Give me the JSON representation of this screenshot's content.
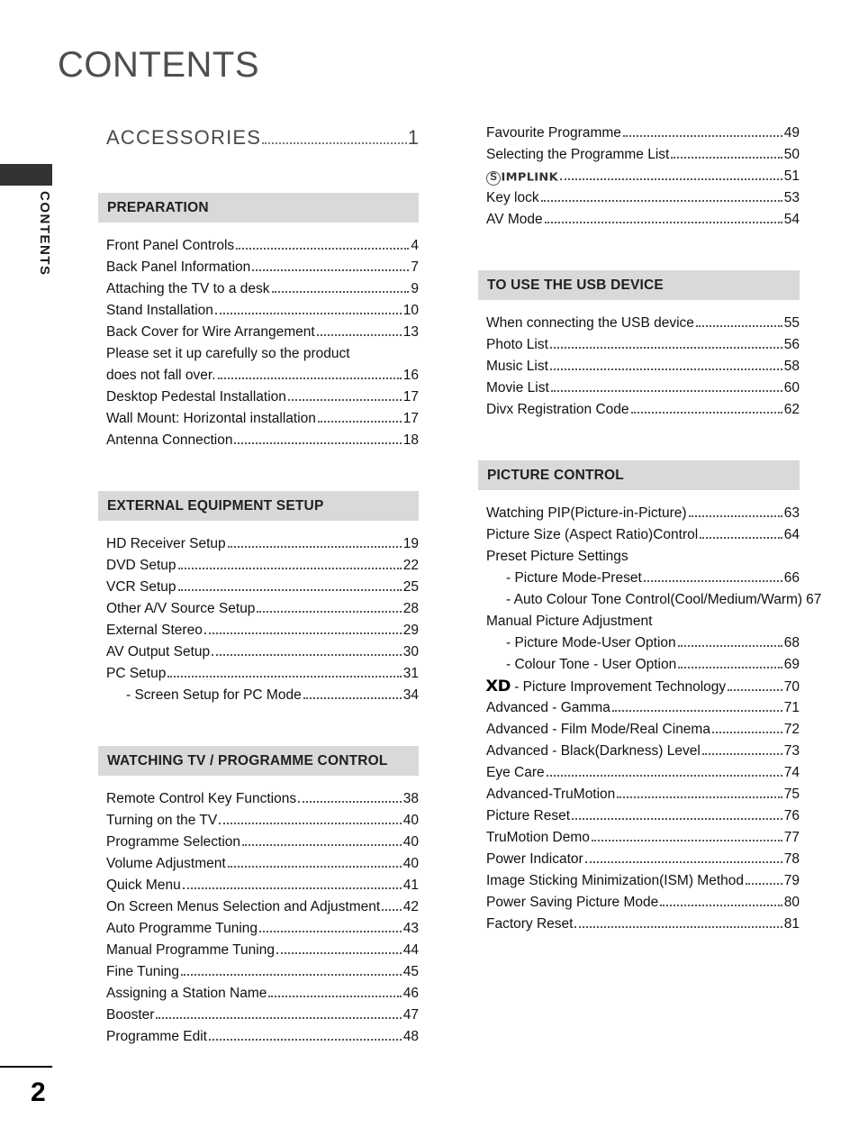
{
  "page": {
    "title": "CONTENTS",
    "margin_label": "CONTENTS",
    "page_number": "2"
  },
  "accessories": {
    "label": "ACCESSORIES",
    "page": "1"
  },
  "left_column": {
    "sections": [
      {
        "title": "PREPARATION",
        "entries": [
          {
            "label": "Front Panel Controls",
            "page": "4"
          },
          {
            "label": "Back Panel Information",
            "page": "7"
          },
          {
            "label": "Attaching the TV to a desk",
            "page": "9"
          },
          {
            "label": "Stand Installation",
            "page": "10"
          },
          {
            "label": "Back Cover for Wire Arrangement",
            "page": "13"
          },
          {
            "label": "Please set it up carefully so the product",
            "page": "",
            "continuation": true
          },
          {
            "label": "does not fall over.",
            "page": "16"
          },
          {
            "label": "Desktop Pedestal Installation",
            "page": "17"
          },
          {
            "label": "Wall Mount: Horizontal installation",
            "page": "17"
          },
          {
            "label": "Antenna Connection",
            "page": "18"
          }
        ]
      },
      {
        "title": "EXTERNAL EQUIPMENT SETUP",
        "entries": [
          {
            "label": "HD Receiver Setup",
            "page": "19"
          },
          {
            "label": "DVD Setup",
            "page": "22"
          },
          {
            "label": "VCR Setup",
            "page": "25"
          },
          {
            "label": "Other A/V Source Setup",
            "page": "28"
          },
          {
            "label": "External Stereo",
            "page": "29"
          },
          {
            "label": "AV Output Setup",
            "page": "30"
          },
          {
            "label": "PC Setup",
            "page": "31"
          },
          {
            "label": "- Screen Setup for PC Mode",
            "page": "34",
            "indent": true
          }
        ]
      },
      {
        "title": "WATCHING TV / PROGRAMME CONTROL",
        "entries": [
          {
            "label": "Remote Control Key Functions",
            "page": "38"
          },
          {
            "label": "Turning on the TV",
            "page": "40"
          },
          {
            "label": "Programme Selection",
            "page": "40"
          },
          {
            "label": "Volume Adjustment",
            "page": "40"
          },
          {
            "label": "Quick Menu",
            "page": "41"
          },
          {
            "label": "On Screen Menus Selection and Adjustment",
            "page": "42"
          },
          {
            "label": "Auto Programme Tuning",
            "page": "43"
          },
          {
            "label": "Manual Programme Tuning",
            "page": "44"
          },
          {
            "label": "Fine Tuning",
            "page": "45"
          },
          {
            "label": "Assigning a Station Name",
            "page": "46"
          },
          {
            "label": "Booster",
            "page": "47"
          },
          {
            "label": "Programme Edit",
            "page": "48"
          }
        ]
      }
    ]
  },
  "right_column": {
    "top_entries": [
      {
        "label": "Favourite Programme",
        "page": "49"
      },
      {
        "label": "Selecting the Programme List",
        "page": "50"
      },
      {
        "label": "SIMPLINK",
        "page": "51",
        "logo": "simplink-logo"
      },
      {
        "label": "Key lock",
        "page": "53"
      },
      {
        "label": "AV Mode",
        "page": "54"
      }
    ],
    "sections": [
      {
        "title": "TO USE THE USB DEVICE",
        "entries": [
          {
            "label": "When connecting the USB device",
            "page": "55"
          },
          {
            "label": "Photo List",
            "page": "56"
          },
          {
            "label": "Music List",
            "page": "58"
          },
          {
            "label": "Movie List",
            "page": "60"
          },
          {
            "label": "Divx Registration Code",
            "page": "62"
          }
        ]
      },
      {
        "title": "PICTURE CONTROL",
        "entries": [
          {
            "label": "Watching PIP(Picture-in-Picture)",
            "page": "63"
          },
          {
            "label": "Picture Size (Aspect Ratio)Control",
            "page": "64"
          },
          {
            "label": "Preset Picture Settings",
            "page": "",
            "continuation": true
          },
          {
            "label": "- Picture Mode-Preset",
            "page": "66",
            "indent": true
          },
          {
            "label": "- Auto Colour Tone Control(Cool/Medium/Warm)",
            "page": "67",
            "indent": true,
            "tight": true
          },
          {
            "label": "Manual Picture Adjustment",
            "page": "",
            "continuation": true
          },
          {
            "label": "- Picture Mode-User Option",
            "page": "68",
            "indent": true
          },
          {
            "label": "- Colour Tone - User Option",
            "page": "69",
            "indent": true
          },
          {
            "label": "- Picture Improvement Technology",
            "page": "70",
            "logo": "xd-logo"
          },
          {
            "label": "Advanced - Gamma",
            "page": "71"
          },
          {
            "label": "Advanced - Film Mode/Real Cinema",
            "page": "72"
          },
          {
            "label": "Advanced - Black(Darkness) Level",
            "page": "73"
          },
          {
            "label": "Eye Care",
            "page": "74"
          },
          {
            "label": "Advanced-TruMotion",
            "page": "75"
          },
          {
            "label": "Picture Reset",
            "page": "76"
          },
          {
            "label": "TruMotion Demo",
            "page": "77"
          },
          {
            "label": "Power Indicator",
            "page": "78"
          },
          {
            "label": "Image Sticking Minimization(ISM) Method",
            "page": "79"
          },
          {
            "label": "Power Saving Picture Mode",
            "page": "80"
          },
          {
            "label": "Factory Reset",
            "page": "81"
          }
        ]
      }
    ],
    "logos": {
      "simplink": {
        "circle_letter": "S",
        "word": "IMPLINK"
      },
      "xd": {
        "text": "XD"
      }
    }
  }
}
